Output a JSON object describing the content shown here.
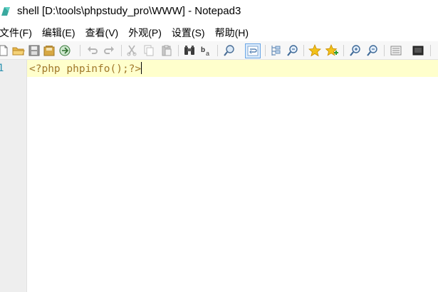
{
  "window": {
    "title": "shell [D:\\tools\\phpstudy_pro\\WWW] - Notepad3"
  },
  "menu": [
    {
      "label": "文件(F)"
    },
    {
      "label": "编辑(E)"
    },
    {
      "label": "查看(V)"
    },
    {
      "label": "外观(P)"
    },
    {
      "label": "设置(S)"
    },
    {
      "label": "帮助(H)"
    }
  ],
  "toolbar": {
    "icons": [
      "new-file-icon",
      "open-folder-icon",
      "save-icon",
      "save-as-icon",
      "browse-icon",
      "undo-icon",
      "redo-icon",
      "cut-icon",
      "copy-icon",
      "paste-icon",
      "find-icon",
      "replace-icon",
      "zoom-find-icon",
      "word-wrap-icon",
      "select-block-icon",
      "find-next-icon",
      "favorite-star-icon",
      "add-favorite-icon",
      "zoom-in-icon",
      "zoom-out-icon",
      "settings-icon",
      "fullscreen-icon"
    ],
    "active_icon": "word-wrap-icon"
  },
  "editor": {
    "line_numbers": [
      "1"
    ],
    "lines": [
      "<?php phpinfo();?>"
    ]
  },
  "colors": {
    "current_line_bg": "#ffffcc",
    "code_text": "#a0782a",
    "line_number": "#2b91af",
    "gutter_bg": "#eeeeee"
  }
}
